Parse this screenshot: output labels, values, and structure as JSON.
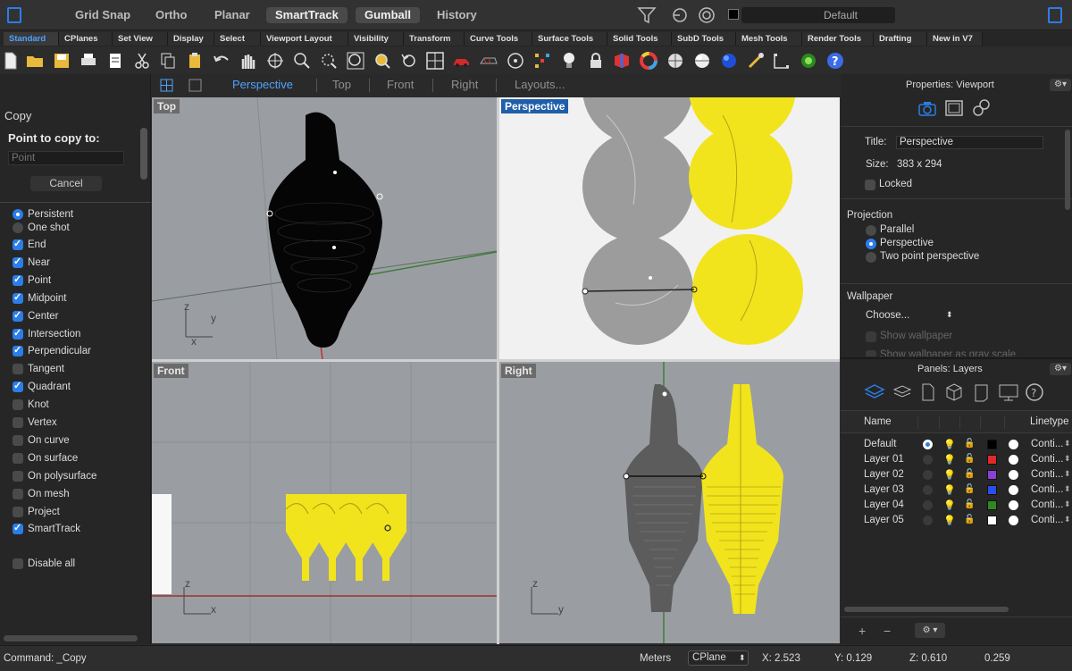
{
  "topbar": {
    "grid_snap": "Grid Snap",
    "ortho": "Ortho",
    "planar": "Planar",
    "smarttrack": "SmartTrack",
    "gumball": "Gumball",
    "history": "History",
    "layer_display": "Default"
  },
  "tabs": [
    "Standard",
    "CPlanes",
    "Set View",
    "Display",
    "Select",
    "Viewport Layout",
    "Visibility",
    "Transform",
    "Curve Tools",
    "Surface Tools",
    "Solid Tools",
    "SubD Tools",
    "Mesh Tools",
    "Render Tools",
    "Drafting",
    "New in V7"
  ],
  "viewport_tabs": {
    "perspective": "Perspective",
    "top": "Top",
    "front": "Front",
    "right": "Right",
    "layouts": "Layouts..."
  },
  "command_panel": {
    "title": "Copy",
    "prompt": "Point to copy to:",
    "input_placeholder": "Point",
    "cancel": "Cancel"
  },
  "osnap": {
    "modes": [
      {
        "label": "Persistent",
        "type": "radio",
        "on": true
      },
      {
        "label": "One shot",
        "type": "radio",
        "on": false
      }
    ],
    "items": [
      {
        "label": "End",
        "on": true
      },
      {
        "label": "Near",
        "on": true
      },
      {
        "label": "Point",
        "on": true
      },
      {
        "label": "Midpoint",
        "on": true
      },
      {
        "label": "Center",
        "on": true
      },
      {
        "label": "Intersection",
        "on": true
      },
      {
        "label": "Perpendicular",
        "on": true
      },
      {
        "label": "Tangent",
        "on": false
      },
      {
        "label": "Quadrant",
        "on": true
      },
      {
        "label": "Knot",
        "on": false
      },
      {
        "label": "Vertex",
        "on": false
      },
      {
        "label": "On curve",
        "on": false
      },
      {
        "label": "On surface",
        "on": false
      },
      {
        "label": "On polysurface",
        "on": false
      },
      {
        "label": "On mesh",
        "on": false
      },
      {
        "label": "Project",
        "on": false
      },
      {
        "label": "SmartTrack",
        "on": true
      }
    ],
    "disable_all": "Disable all"
  },
  "viewports": {
    "top": "Top",
    "perspective": "Perspective",
    "front": "Front",
    "right": "Right",
    "axis_x": "x",
    "axis_y": "y",
    "axis_z": "z"
  },
  "properties": {
    "header": "Properties: Viewport",
    "title_label": "Title:",
    "title_value": "Perspective",
    "size_label": "Size:",
    "size_value": "383 x 294",
    "locked": "Locked",
    "projection_label": "Projection",
    "projection_options": [
      {
        "label": "Parallel",
        "on": false
      },
      {
        "label": "Perspective",
        "on": true
      },
      {
        "label": "Two point perspective",
        "on": false
      }
    ],
    "wallpaper_label": "Wallpaper",
    "choose": "Choose...",
    "show_wallpaper": "Show wallpaper",
    "show_gray": "Show wallpaper as gray scale"
  },
  "layers": {
    "header": "Panels: Layers",
    "col_name": "Name",
    "col_linetype": "Linetype",
    "rows": [
      {
        "name": "Default",
        "color": "#000000",
        "linetype": "Conti...",
        "current": true
      },
      {
        "name": "Layer 01",
        "color": "#e02a2a",
        "linetype": "Conti...",
        "current": false
      },
      {
        "name": "Layer 02",
        "color": "#8a3fd6",
        "linetype": "Conti...",
        "current": false
      },
      {
        "name": "Layer 03",
        "color": "#2a4fe6",
        "linetype": "Conti...",
        "current": false
      },
      {
        "name": "Layer 04",
        "color": "#2e8a1e",
        "linetype": "Conti...",
        "current": false
      },
      {
        "name": "Layer 05",
        "color": "#ffffff",
        "linetype": "Conti...",
        "current": false
      }
    ]
  },
  "status": {
    "command": "Command: _Copy",
    "units": "Meters",
    "cplane": "CPlane",
    "x": "X: 2.523",
    "y": "Y: 0.129",
    "z": "Z: 0.610",
    "dist": "0.259"
  },
  "colors": {
    "accent": "#2b7de9",
    "yellow_object": "#f2e41c",
    "viewport_bg": "#9a9ea3"
  }
}
